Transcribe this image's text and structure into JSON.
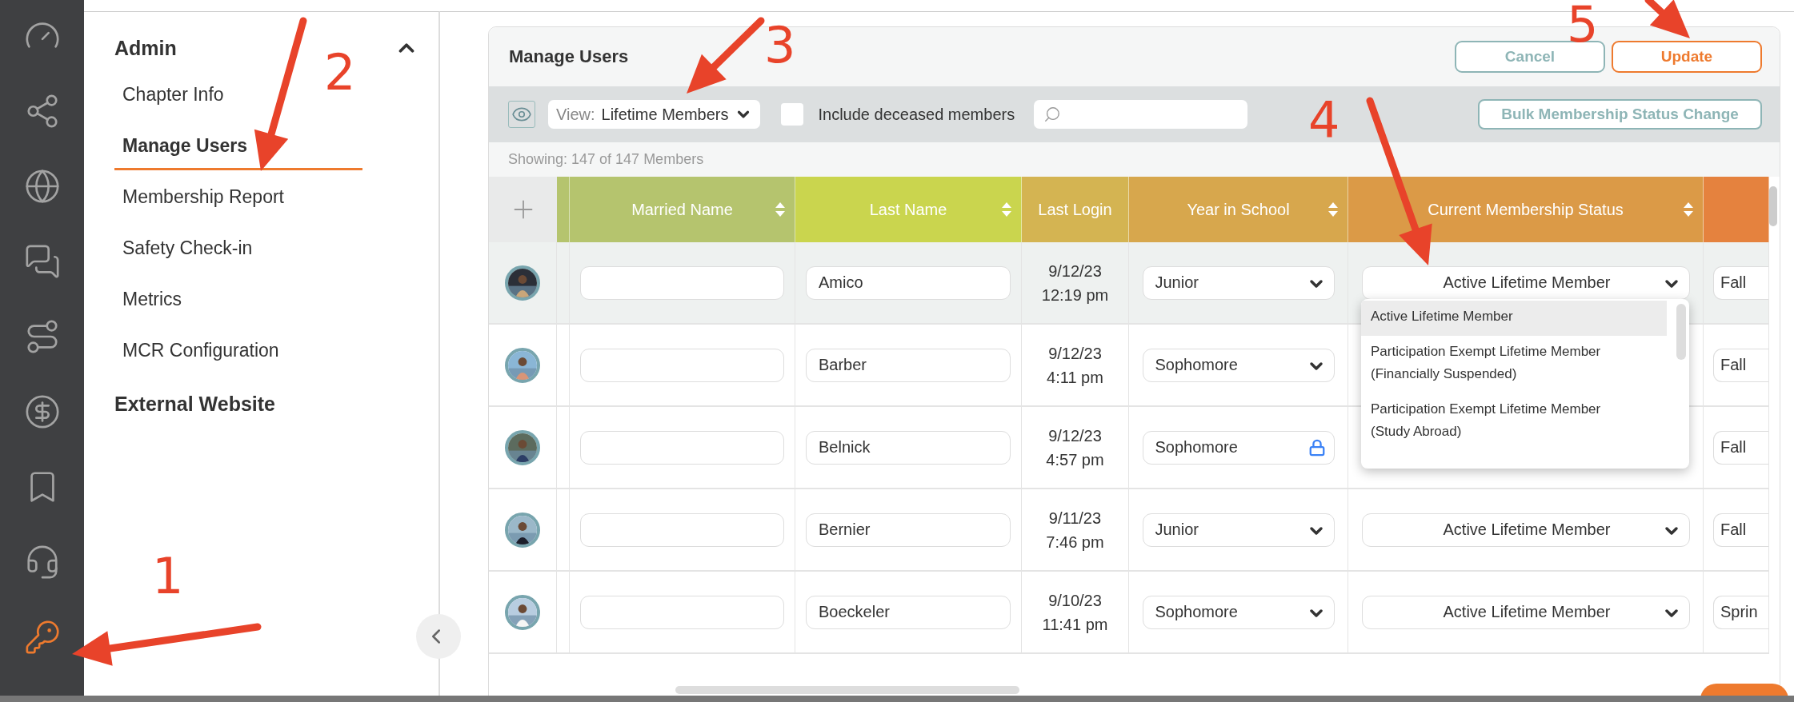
{
  "rail": [
    {
      "kind": "gauge",
      "active": false
    },
    {
      "kind": "network",
      "active": false
    },
    {
      "kind": "globe",
      "active": false
    },
    {
      "kind": "chat",
      "active": false
    },
    {
      "kind": "plays",
      "active": false
    },
    {
      "kind": "dollar",
      "active": false
    },
    {
      "kind": "bookmarks",
      "active": false
    },
    {
      "kind": "headset",
      "active": false
    },
    {
      "kind": "key",
      "active": true
    }
  ],
  "sidebar": {
    "sections": [
      {
        "title": "Admin",
        "expanded": true,
        "items": [
          {
            "label": "Chapter Info",
            "selected": false
          },
          {
            "label": "Manage Users",
            "selected": true
          },
          {
            "label": "Membership Report",
            "selected": false
          },
          {
            "label": "Safety Check-in",
            "selected": false
          },
          {
            "label": "Metrics",
            "selected": false
          },
          {
            "label": "MCR Configuration",
            "selected": false
          }
        ]
      },
      {
        "title": "External Website"
      }
    ]
  },
  "panel": {
    "title": "Manage Users",
    "buttons": [
      {
        "label": "Cancel",
        "kind": "secondary"
      },
      {
        "label": "Update",
        "kind": "primary"
      }
    ],
    "toolbar": {
      "view_prefix": "View:",
      "view_value": "Lifetime Members",
      "include_deceased": {
        "label": "Include deceased members",
        "checked": false
      },
      "bulk_button": "Bulk Membership Status Change"
    },
    "showing": "Showing: 147 of 147 Members",
    "columns": [
      {
        "label": "Married Name",
        "sortable": true,
        "color": "#b5c46e"
      },
      {
        "label": "Last Name",
        "sortable": true,
        "color": "#cad54e"
      },
      {
        "label": "Last Login",
        "sortable": false,
        "color": "#d4b452"
      },
      {
        "label": "Year in School",
        "sortable": true,
        "color": "#d7a74d"
      },
      {
        "label": "Current Membership Status",
        "sortable": true,
        "color": "#db9a47"
      },
      {
        "color": "#e5823e"
      }
    ],
    "rows": [
      {
        "highlighted": true,
        "last_name": "Amico",
        "login_date": "9/12/23",
        "login_time": "12:19 pm",
        "year": "Junior",
        "autofill_icon": false,
        "status": "Active Lifetime Member",
        "term": "Fall",
        "status_menu": [
          {
            "label": "Active Lifetime Member",
            "selected": true
          },
          {
            "label": "Participation Exempt Lifetime Member (Financially Suspended)",
            "selected": false
          },
          {
            "label": "Participation Exempt Lifetime Member (Study Abroad)",
            "selected": false
          }
        ]
      },
      {
        "highlighted": false,
        "last_name": "Barber",
        "login_date": "9/12/23",
        "login_time": "4:11 pm",
        "year": "Sophomore",
        "autofill_icon": false,
        "term": "Fall"
      },
      {
        "highlighted": false,
        "last_name": "Belnick",
        "login_date": "9/12/23",
        "login_time": "4:57 pm",
        "year": "Sophomore",
        "autofill_icon": true,
        "term": "Fall"
      },
      {
        "highlighted": false,
        "last_name": "Bernier",
        "login_date": "9/11/23",
        "login_time": "7:46 pm",
        "year": "Junior",
        "autofill_icon": false,
        "status": "Active Lifetime Member",
        "term": "Fall"
      },
      {
        "highlighted": false,
        "last_name": "Boeckeler",
        "login_date": "9/10/23",
        "login_time": "11:41 pm",
        "year": "Sophomore",
        "autofill_icon": false,
        "status": "Active Lifetime Member",
        "term": "Sprin"
      }
    ]
  },
  "annotations": [
    {
      "label": "1"
    },
    {
      "label": "2"
    },
    {
      "label": "3"
    },
    {
      "label": "4"
    },
    {
      "label": "5"
    }
  ]
}
